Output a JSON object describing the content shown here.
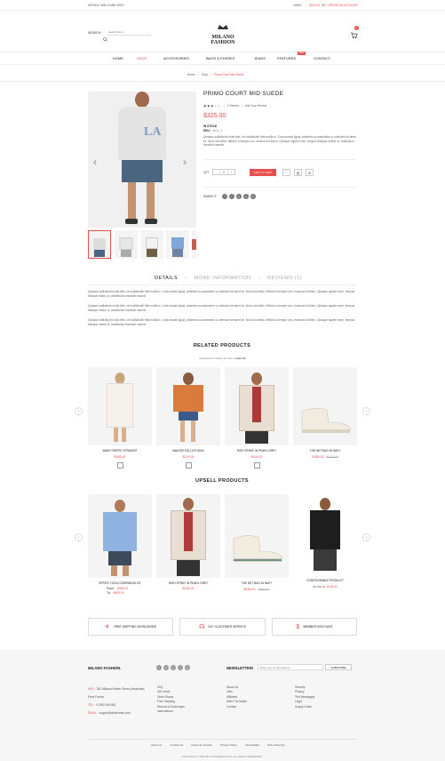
{
  "topbar": {
    "welcome": "DEFAULT WELCOME MSG!",
    "links": "LINKS",
    "sign_in": "SIGN IN",
    "or": "OR",
    "create_account": "CREATE AN ACCOUNT"
  },
  "logo": {
    "line1": "MILANO",
    "line2": "FASHION"
  },
  "search": {
    "label": "SEARCH",
    "placeholder": "Search here..."
  },
  "cart": {
    "count": "0"
  },
  "nav": {
    "items": [
      "HOME",
      "SHOP",
      "ACCESSORIES",
      "BAGS & PURSES",
      "JEANS",
      "FEATURES",
      "CONTACT"
    ],
    "new_badge": "NEW",
    "active_color": "#e8504d"
  },
  "breadcrumb": {
    "home": "Home",
    "shop": "Shop",
    "current": "Primo Court Mid Suede"
  },
  "product": {
    "title": "PRIMO COURT MID SUEDE",
    "review_count": "1 Review",
    "add_review": "Add Your Review",
    "rating": 3,
    "price": "$325.00",
    "stock": "IN STOCK",
    "sku_label": "SKU:",
    "sku": "demo_4",
    "desc": "Quisque sollicitudin nulla felis, vel sollicitudin felis mollis in. Cras mauris ligula, pharetra a consectetur a, interdum sit amet ex. Nunc dui tellus, efficitur a tempor non, euismod id libero. Quisque sapien enim, tempus tristique metus ut, vestibulum tincidunt mauris!",
    "qty_label": "QTY",
    "qty_value": "1",
    "add_to_cart": "ADD TO CART",
    "share_label": "SHARE IT:",
    "share_icons": [
      "facebook-icon",
      "twitter-icon",
      "google-icon",
      "pinterest-icon",
      "linkedin-icon"
    ]
  },
  "tabs": {
    "details": "DETAILS",
    "more_info": "MORE INFORMATION",
    "reviews": "REVIEWS (1)"
  },
  "details_text": [
    "Quisque sollicitudin nulla felis, vel sollicitudin felis mollis in. Cras mauris ligula, pharetra a consectetur a, interdum sit amet ex. Nunc dui tellus, efficitur a tempor non, euismod id libero. Quisque sapien enim, tempus tristique metus ut, vestibulum tincidunt mauris!",
    "Quisque sollicitudin nulla felis, vel sollicitudin felis mollis in. Cras mauris ligula, pharetra a consectetur a, interdum sit amet ex. Nunc dui tellus, efficitur a tempor non, euismod id libero. Quisque sapien enim, tempus tristique metus ut, vestibulum tincidunt mauris!",
    "Quisque sollicitudin nulla felis, vel sollicitudin felis mollis in. Cras mauris ligula, pharetra a consectetur a, interdum sit amet ex. Nunc dui tellus, efficitur a tempor non, euismod id libero. Quisque sapien enim, tempus tristique metus ut, vestibulum tincidunt mauris!"
  ],
  "related": {
    "title": "RELATED PRODUCTS",
    "hint": "Check items to add to the cart or",
    "select_all": "select all",
    "items": [
      {
        "name": "WAKE GRIPED STRAIGHT",
        "price": "$369.00",
        "old": ""
      },
      {
        "name": "MAURIS SOLLICITUDIN",
        "price": "$219.00",
        "old": ""
      },
      {
        "name": "HIGH SPRAY IN PEARL GREY",
        "price": "$234.00",
        "old": ""
      },
      {
        "name": "THE NET BAG IN NAVY",
        "price": "$286.00",
        "old": "$300.00"
      }
    ]
  },
  "upsell": {
    "title": "UPSELL PRODUCTS",
    "items": [
      {
        "name": "SPRITE YOGA COMPANION KIT",
        "from_label": "From:",
        "from": "$365.00",
        "to_label": "To:",
        "to": "$509.00"
      },
      {
        "name": "HIGH SPRAY IN PEARL GREY",
        "price": "$234.00"
      },
      {
        "name": "THE NET BAG IN NAVY",
        "price": "$286.00",
        "old": "$300.00"
      },
      {
        "name": "CONFIGURABLE PRODUCT",
        "as_low": "As low as",
        "price": "$136.00"
      }
    ]
  },
  "services": [
    {
      "icon": "plane-icon",
      "label": "FREE SHIPPING WORLDWIDE"
    },
    {
      "icon": "headphones-icon",
      "label": "24/7 CUSTOMER SERVICE"
    },
    {
      "icon": "money-icon",
      "label": "MEMBER DISCOUNT"
    }
  ],
  "footer": {
    "brand": "MILANO FASHION.",
    "address_label": "ADD:",
    "address": "282 Milanow Mimer Street (Ismaniate)",
    "city": "Paris France",
    "tel_label": "TEL:",
    "tel": "+1 890 345 908",
    "email_label": "EMAIL:",
    "email": "support@alothemes.com",
    "newsletter": "NEWSLETTER!",
    "newsletter_placeholder": "Enter your email address",
    "subscribe": "SUBSCRIBE",
    "col1": [
      "FAQ",
      "Gift Cards",
      "Order Status",
      "Free Shipping",
      "Returns & Exchanges",
      "International"
    ],
    "col2": [
      "About Us",
      "Jobs",
      "Affiliates",
      "Meet The Maker",
      "Contact"
    ],
    "col3": [
      "Security",
      "Privacy",
      "Text Messaging",
      "Legal",
      "Supply Chain"
    ],
    "bottom_links": [
      "About Us",
      "Contact Us",
      "Customer Service",
      "Privacy Policy",
      "Accessibility",
      "Store Directory"
    ],
    "copyright": "COPYRIGHT © 2016 BY ALOTHEMES.COM. ALL RIGHTS RESERVED."
  }
}
